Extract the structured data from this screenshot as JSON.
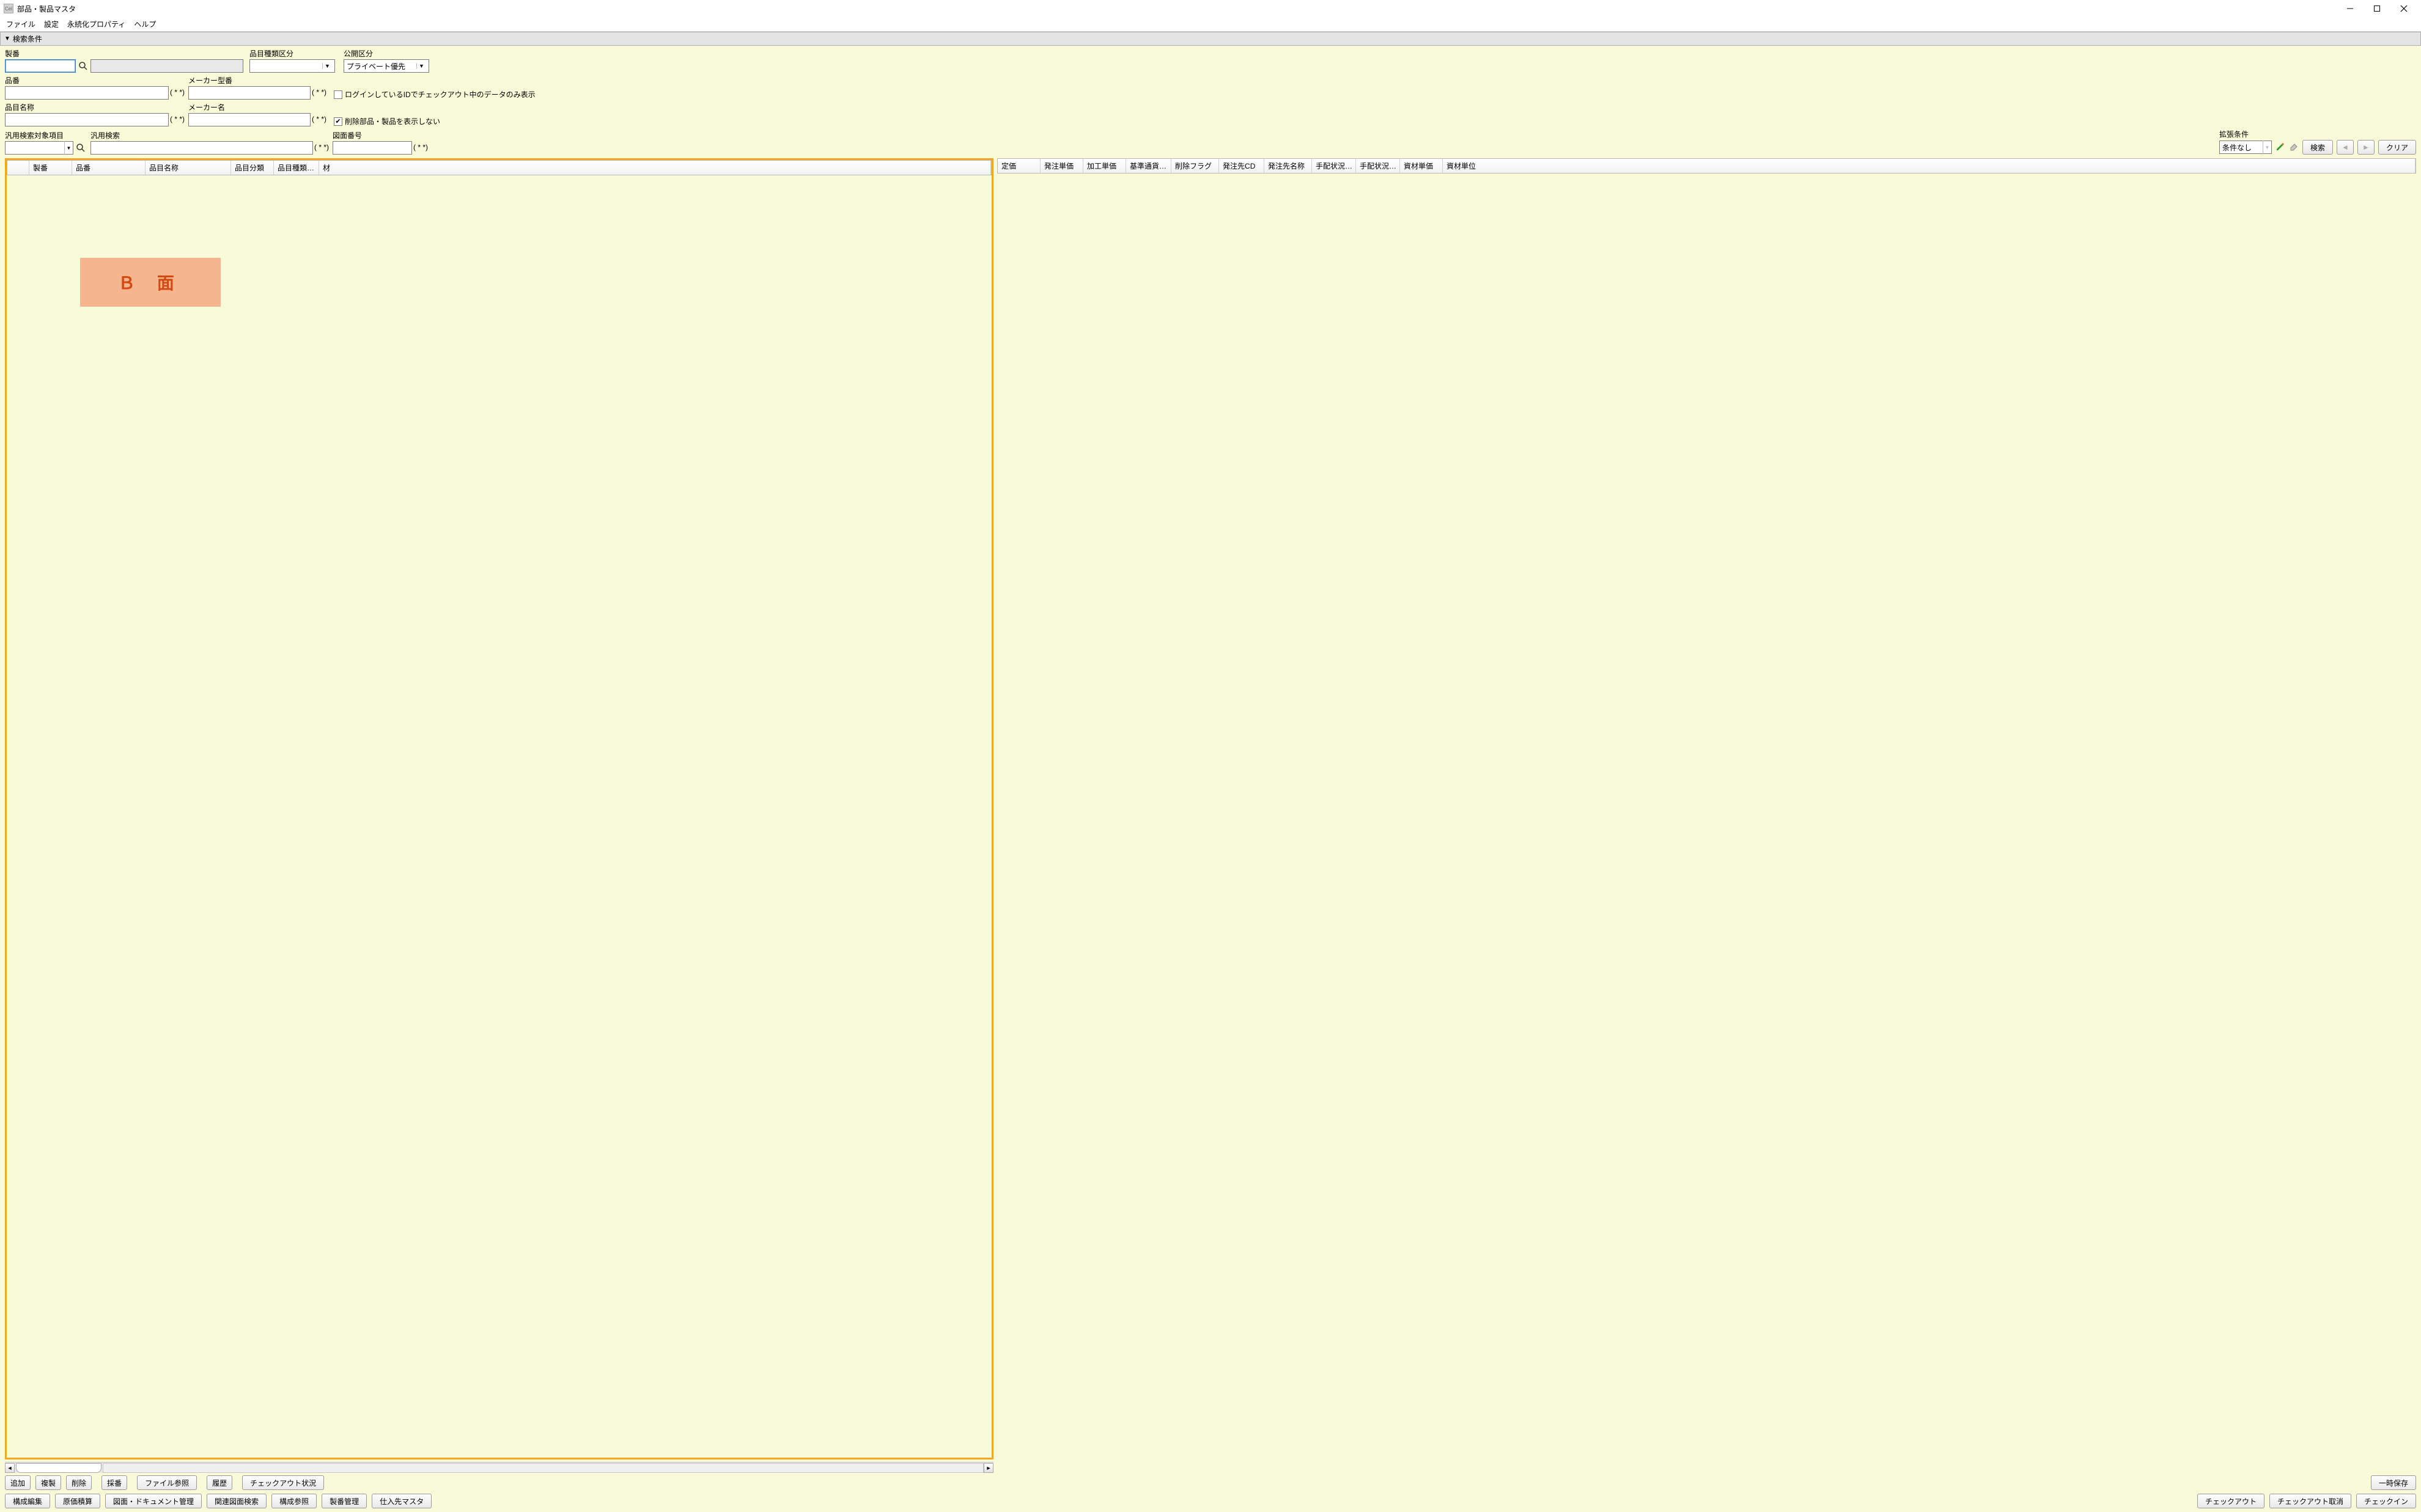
{
  "window": {
    "app_icon_text": "Cel",
    "title": "部品・製品マスタ"
  },
  "menu": [
    "ファイル",
    "設定",
    "永続化プロパティ",
    "ヘルプ"
  ],
  "section_header": "検索条件",
  "labels": {
    "seiban": "製番",
    "hinmoku_shurui_kubun": "品目種類区分",
    "koukai_kubun": "公開区分",
    "hinban": "品番",
    "maker_kataban": "メーカー型番",
    "hinmoku_meisho": "品目名称",
    "maker_mei": "メーカー名",
    "hanyou_kensaku_taishou": "汎用検索対象項目",
    "hanyou_kensaku": "汎用検索",
    "zumen_bangou": "図面番号",
    "kakuchou_jouken": "拡張条件"
  },
  "values": {
    "koukai_kubun_selected": "プライベート優先",
    "kakuchou_jouken_selected": "条件なし"
  },
  "wildcards": "( * *)",
  "checks": {
    "login_id_checkout_only": "ログインしているIDでチェックアウト中のデータのみ表示",
    "hide_deleted": "削除部品・製品を表示しない"
  },
  "buttons": {
    "search": "検索",
    "clear": "クリア",
    "add": "追加",
    "copy": "複製",
    "delete": "削除",
    "saiban": "採番",
    "file_ref": "ファイル参照",
    "history": "履歴",
    "checkout_status": "チェックアウト状況",
    "temp_save": "一時保存",
    "kousei_edit": "構成編集",
    "genka_sekisan": "原価積算",
    "zumen_doc_mgmt": "図面・ドキュメント管理",
    "kanren_zumen_search": "関連図面検索",
    "kousei_sanshou": "構成参照",
    "seiban_kanri": "製番管理",
    "shiiresaki_master": "仕入先マスタ",
    "checkout": "チェックアウト",
    "checkout_cancel": "チェックアウト取消",
    "checkin": "チェックイン"
  },
  "left_grid_cols": [
    "",
    "製番",
    "品番",
    "品目名称",
    "品目分類",
    "品目種類…",
    "材"
  ],
  "right_grid_cols": [
    "定価",
    "発注単価",
    "加工単価",
    "基準通貨…",
    "削除フラグ",
    "発注先CD",
    "発注先名称",
    "手配状況…",
    "手配状況…",
    "資材単価",
    "資材単位"
  ],
  "overlay_text": "Ｂ 面"
}
